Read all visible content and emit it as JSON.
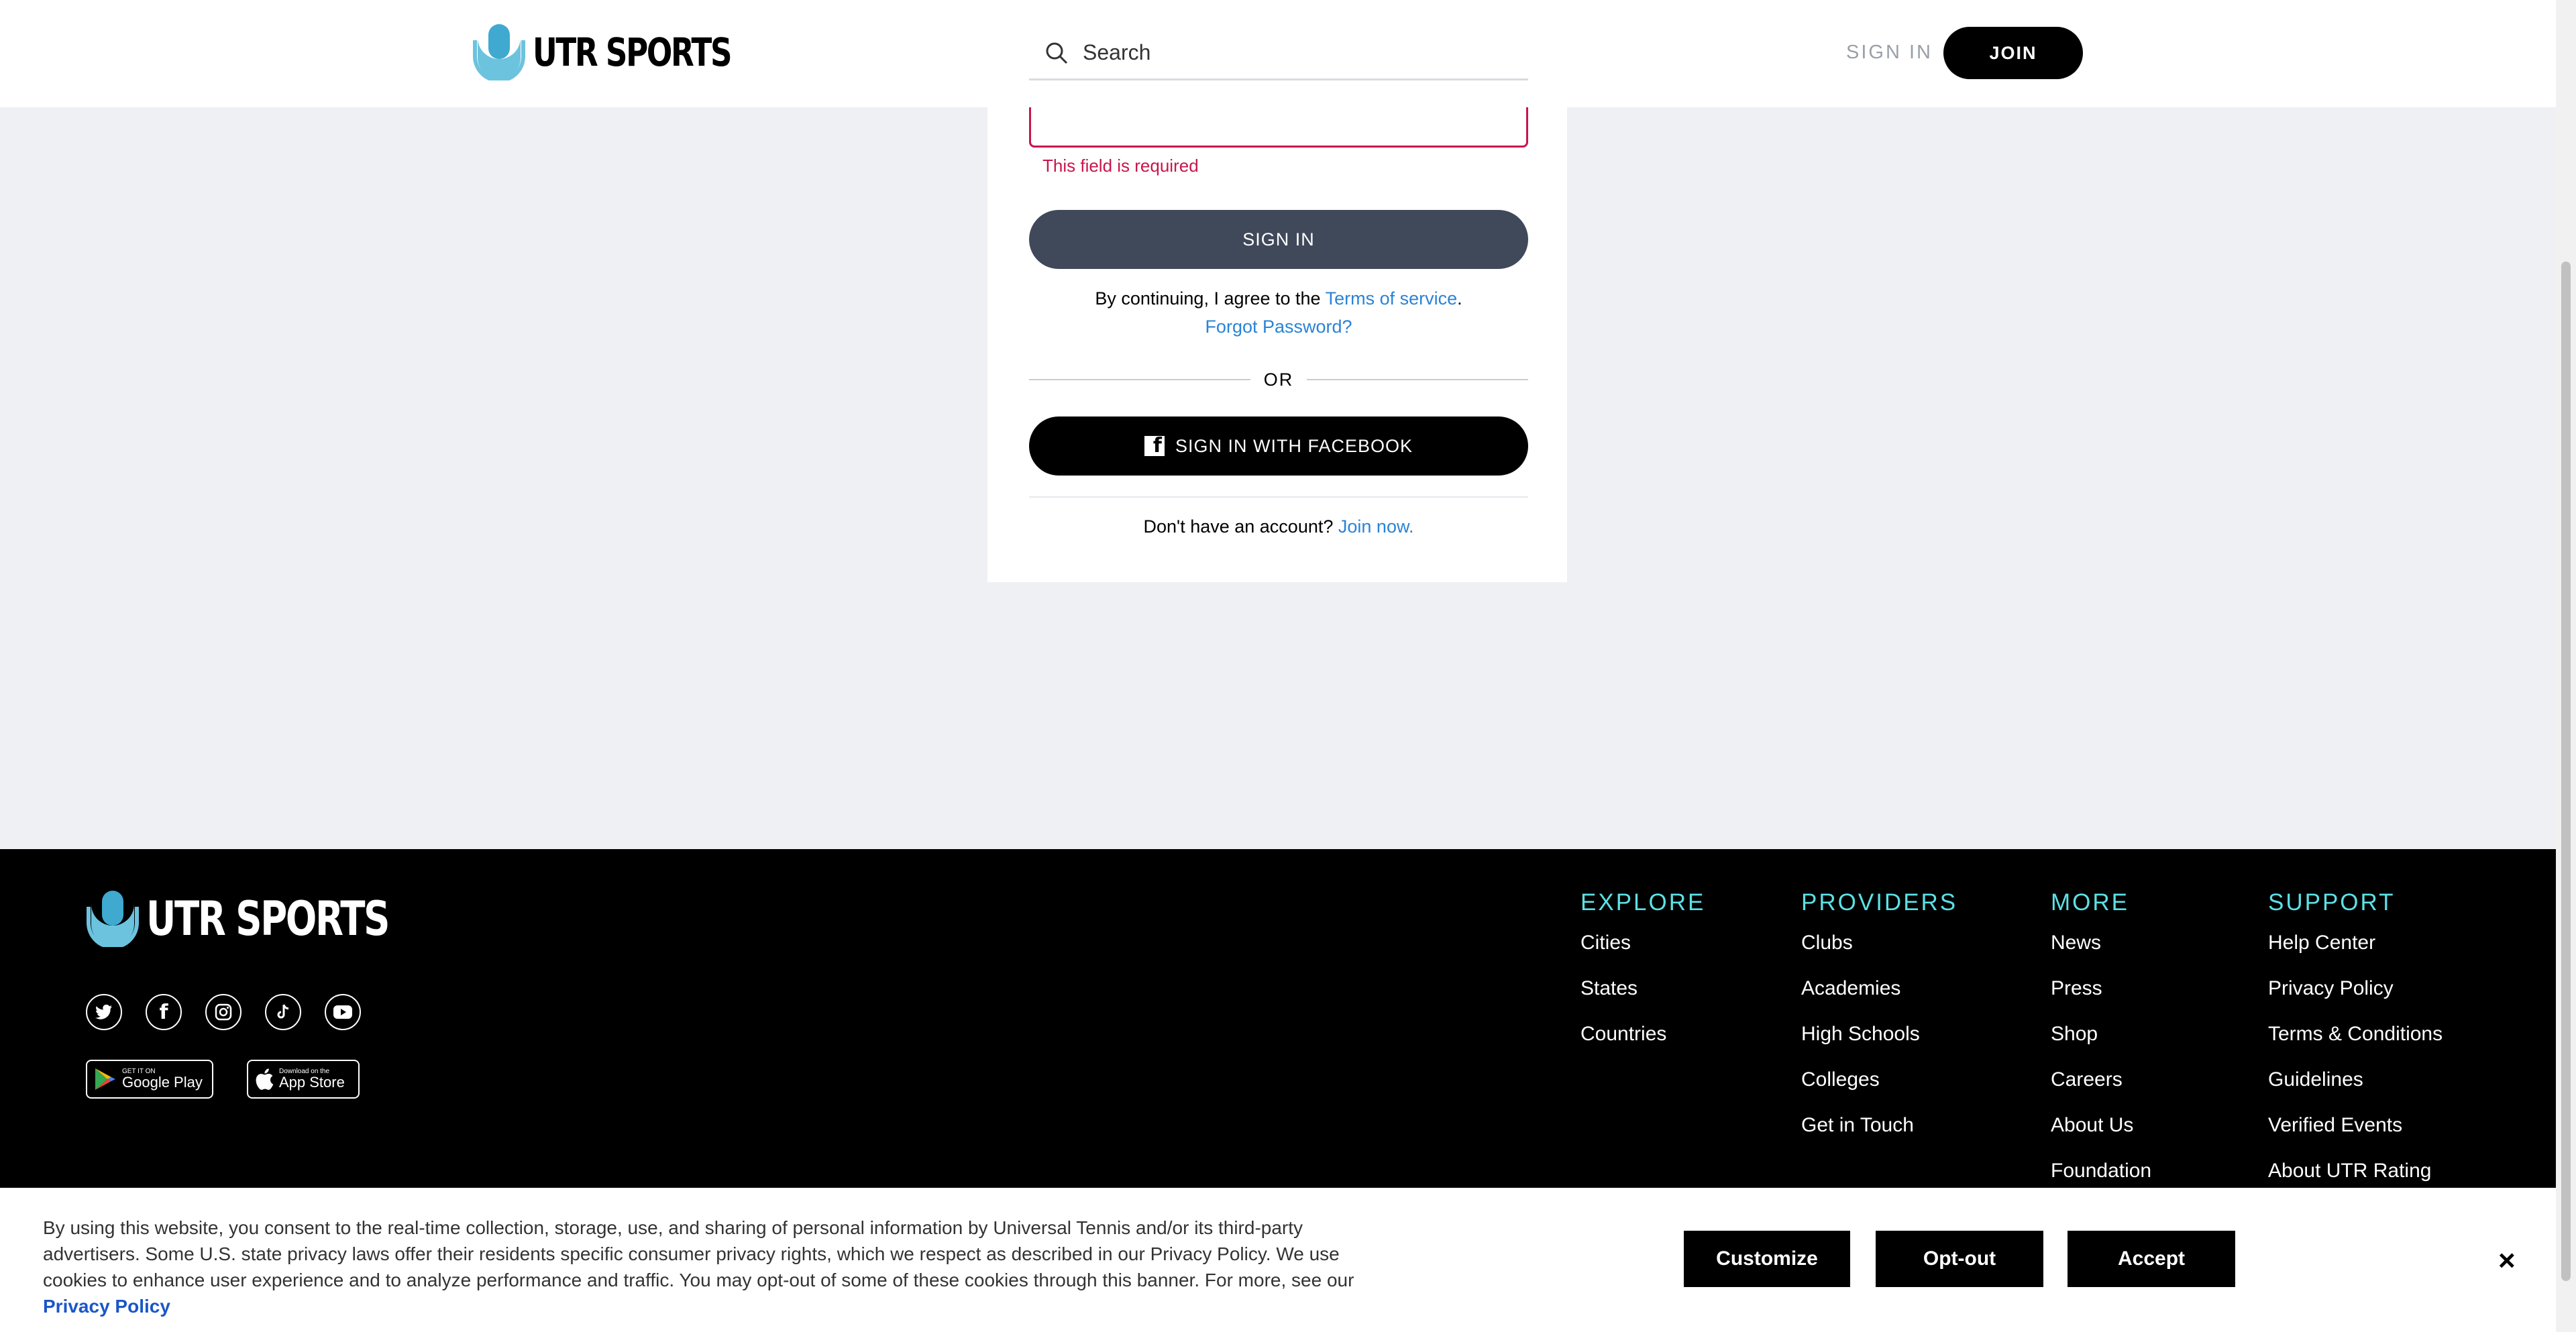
{
  "header": {
    "logo_text": "UTR SPORTS",
    "search_placeholder": "Search",
    "sign_in": "SIGN IN",
    "join": "JOIN"
  },
  "login": {
    "error": "This field is required",
    "sign_in_button": "SIGN IN",
    "agree_prefix": "By continuing, I agree to the",
    "terms_link": "Terms of service",
    "agree_suffix": ".",
    "forgot_password": "Forgot Password?",
    "or": "OR",
    "facebook_button": "SIGN IN WITH FACEBOOK",
    "no_account": "Don't have an account?",
    "join_now": "Join now."
  },
  "footer": {
    "logo_text": "UTR SPORTS",
    "social": [
      "twitter-icon",
      "facebook-icon",
      "instagram-icon",
      "tiktok-icon",
      "youtube-icon"
    ],
    "stores": {
      "google_small": "GET IT ON",
      "google_big": "Google Play",
      "apple_small": "Download on the",
      "apple_big": "App Store"
    },
    "columns": [
      {
        "title": "EXPLORE",
        "items": [
          "Cities",
          "States",
          "Countries"
        ]
      },
      {
        "title": "PROVIDERS",
        "items": [
          "Clubs",
          "Academies",
          "High Schools",
          "Colleges",
          "Get in Touch"
        ]
      },
      {
        "title": "MORE",
        "items": [
          "News",
          "Press",
          "Shop",
          "Careers",
          "About Us",
          "Foundation"
        ]
      },
      {
        "title": "SUPPORT",
        "items": [
          "Help Center",
          "Privacy Policy",
          "Terms & Conditions",
          "Guidelines",
          "Verified Events",
          "About UTR Rating"
        ]
      }
    ]
  },
  "cookie": {
    "text": "By using this website, you consent to the real-time collection, storage, use, and sharing of personal information by Universal Tennis and/or its third-party advertisers. Some U.S. state privacy laws offer their residents specific consumer privacy rights, which we respect as described in our Privacy Policy. We use cookies to enhance user experience and to analyze performance and traffic. You may opt-out of some of these cookies through this banner. For more, see our",
    "privacy_link": "Privacy Policy",
    "customize": "Customize",
    "opt_out": "Opt-out",
    "accept": "Accept",
    "close": "×"
  },
  "colors": {
    "accent_teal": "#5ce1e6",
    "error_red": "#c8154c",
    "link_blue": "#2a83d6",
    "signin_button": "#40495a"
  }
}
